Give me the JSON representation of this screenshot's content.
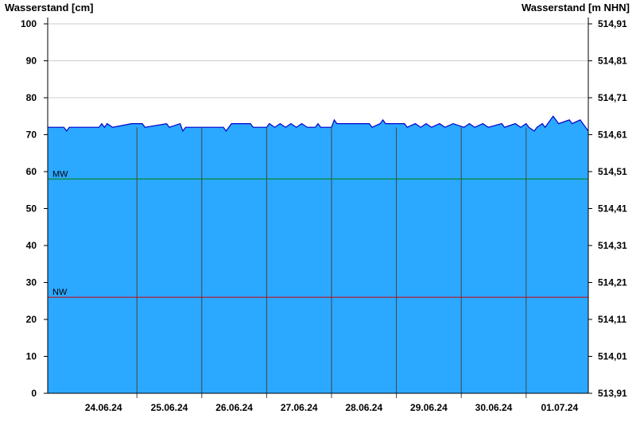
{
  "chart_data": {
    "type": "area",
    "ylabel_left": "Wasserstand [cm]",
    "ylabel_right": "Wasserstand [m NHN]",
    "ylim": [
      0,
      100
    ],
    "y_ticks": [
      0,
      10,
      20,
      30,
      40,
      50,
      60,
      70,
      80,
      90,
      100
    ],
    "y_right_ticks": [
      "513,91",
      "514,01",
      "514,11",
      "514,21",
      "514,31",
      "514,41",
      "514,51",
      "514,61",
      "514,71",
      "514,81",
      "514,91"
    ],
    "x_tick_labels": [
      "24.06.24",
      "25.06.24",
      "26.06.24",
      "27.06.24",
      "28.06.24",
      "29.06.24",
      "30.06.24",
      "01.07.24"
    ],
    "xlim": [
      "2024-06-23T15:00",
      "2024-07-01T23:00"
    ],
    "day_boundaries": [
      "2024-06-25T00:00",
      "2024-06-26T00:00",
      "2024-06-27T00:00",
      "2024-06-28T00:00",
      "2024-06-29T00:00",
      "2024-06-30T00:00",
      "2024-07-01T00:00"
    ],
    "reference_lines": [
      {
        "label": "MW",
        "value": 58,
        "color": "#008000"
      },
      {
        "label": "NW",
        "value": 26,
        "color": "#cc0000"
      }
    ],
    "series": [
      {
        "fill_color": "#2ba8ff",
        "line_color": "#0000cc",
        "points": [
          [
            "2024-06-23T15:00",
            72
          ],
          [
            "2024-06-23T21:00",
            72
          ],
          [
            "2024-06-23T22:00",
            71
          ],
          [
            "2024-06-23T23:00",
            72
          ],
          [
            "2024-06-24T10:00",
            72
          ],
          [
            "2024-06-24T11:00",
            73
          ],
          [
            "2024-06-24T12:00",
            72
          ],
          [
            "2024-06-24T13:00",
            73
          ],
          [
            "2024-06-24T15:00",
            72
          ],
          [
            "2024-06-24T22:00",
            73
          ],
          [
            "2024-06-25T02:00",
            73
          ],
          [
            "2024-06-25T03:00",
            72
          ],
          [
            "2024-06-25T11:00",
            73
          ],
          [
            "2024-06-25T12:00",
            72
          ],
          [
            "2024-06-25T16:00",
            73
          ],
          [
            "2024-06-25T17:00",
            71
          ],
          [
            "2024-06-25T18:00",
            72
          ],
          [
            "2024-06-26T08:00",
            72
          ],
          [
            "2024-06-26T09:00",
            71
          ],
          [
            "2024-06-26T11:00",
            73
          ],
          [
            "2024-06-26T18:00",
            73
          ],
          [
            "2024-06-26T19:00",
            72
          ],
          [
            "2024-06-27T00:00",
            72
          ],
          [
            "2024-06-27T01:00",
            73
          ],
          [
            "2024-06-27T03:00",
            72
          ],
          [
            "2024-06-27T05:00",
            73
          ],
          [
            "2024-06-27T07:00",
            72
          ],
          [
            "2024-06-27T09:00",
            73
          ],
          [
            "2024-06-27T11:00",
            72
          ],
          [
            "2024-06-27T13:00",
            73
          ],
          [
            "2024-06-27T15:00",
            72
          ],
          [
            "2024-06-27T18:00",
            72
          ],
          [
            "2024-06-27T19:00",
            73
          ],
          [
            "2024-06-27T20:00",
            72
          ],
          [
            "2024-06-28T00:00",
            72
          ],
          [
            "2024-06-28T01:00",
            74
          ],
          [
            "2024-06-28T02:00",
            73
          ],
          [
            "2024-06-28T14:00",
            73
          ],
          [
            "2024-06-28T15:00",
            72
          ],
          [
            "2024-06-28T18:00",
            73
          ],
          [
            "2024-06-28T19:00",
            74
          ],
          [
            "2024-06-28T20:00",
            73
          ],
          [
            "2024-06-29T03:00",
            73
          ],
          [
            "2024-06-29T04:00",
            72
          ],
          [
            "2024-06-29T07:00",
            73
          ],
          [
            "2024-06-29T09:00",
            72
          ],
          [
            "2024-06-29T11:00",
            73
          ],
          [
            "2024-06-29T13:00",
            72
          ],
          [
            "2024-06-29T16:00",
            73
          ],
          [
            "2024-06-29T18:00",
            72
          ],
          [
            "2024-06-29T21:00",
            73
          ],
          [
            "2024-06-30T01:00",
            72
          ],
          [
            "2024-06-30T03:00",
            73
          ],
          [
            "2024-06-30T05:00",
            72
          ],
          [
            "2024-06-30T08:00",
            73
          ],
          [
            "2024-06-30T10:00",
            72
          ],
          [
            "2024-06-30T15:00",
            73
          ],
          [
            "2024-06-30T16:00",
            72
          ],
          [
            "2024-06-30T20:00",
            73
          ],
          [
            "2024-06-30T22:00",
            72
          ],
          [
            "2024-07-01T00:00",
            73
          ],
          [
            "2024-07-01T01:00",
            72
          ],
          [
            "2024-07-01T03:00",
            71
          ],
          [
            "2024-07-01T04:00",
            72
          ],
          [
            "2024-07-01T06:00",
            73
          ],
          [
            "2024-07-01T07:00",
            72
          ],
          [
            "2024-07-01T10:00",
            75
          ],
          [
            "2024-07-01T11:00",
            74
          ],
          [
            "2024-07-01T12:00",
            73
          ],
          [
            "2024-07-01T16:00",
            74
          ],
          [
            "2024-07-01T17:00",
            73
          ],
          [
            "2024-07-01T20:00",
            74
          ],
          [
            "2024-07-01T21:00",
            73
          ],
          [
            "2024-07-01T22:00",
            72
          ],
          [
            "2024-07-01T23:00",
            71
          ]
        ]
      }
    ],
    "axis_color": "#000000",
    "gridline_color": "#cccccc",
    "divider_color": "#444444",
    "grid": true
  }
}
